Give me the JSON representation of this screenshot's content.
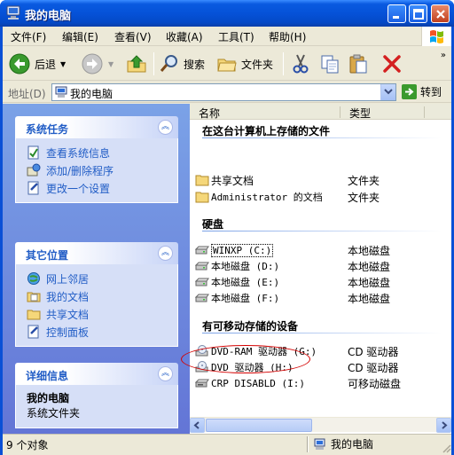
{
  "window": {
    "title": "我的电脑"
  },
  "menu": [
    "文件(F)",
    "编辑(E)",
    "查看(V)",
    "收藏(A)",
    "工具(T)",
    "帮助(H)"
  ],
  "toolbar": {
    "back": "后退",
    "search": "搜索",
    "folders": "文件夹"
  },
  "address": {
    "label": "地址(D)",
    "value": "我的电脑",
    "go": "转到"
  },
  "tasks": {
    "system": {
      "title": "系统任务",
      "items": [
        "查看系统信息",
        "添加/删除程序",
        "更改一个设置"
      ]
    },
    "other": {
      "title": "其它位置",
      "items": [
        "网上邻居",
        "我的文档",
        "共享文档",
        "控制面板"
      ]
    },
    "details": {
      "title": "详细信息",
      "name": "我的电脑",
      "desc": "系统文件夹"
    }
  },
  "columns": {
    "name": "名称",
    "type": "类型"
  },
  "groups": [
    {
      "title": "在这台计算机上存储的文件",
      "items": [
        {
          "name": "共享文档",
          "type": "文件夹",
          "icon": "folder"
        },
        {
          "name": "Administrator 的文档",
          "type": "文件夹",
          "icon": "folder"
        }
      ]
    },
    {
      "title": "硬盘",
      "items": [
        {
          "name": "WINXP (C:)",
          "type": "本地磁盘",
          "icon": "hard-drive"
        },
        {
          "name": "本地磁盘 (D:)",
          "type": "本地磁盘",
          "icon": "hard-drive"
        },
        {
          "name": "本地磁盘 (E:)",
          "type": "本地磁盘",
          "icon": "hard-drive"
        },
        {
          "name": "本地磁盘 (F:)",
          "type": "本地磁盘",
          "icon": "hard-drive"
        }
      ]
    },
    {
      "title": "有可移动存储的设备",
      "items": [
        {
          "name": "DVD-RAM 驱动器 (G:)",
          "type": "CD 驱动器",
          "icon": "dvd-drive"
        },
        {
          "name": "DVD 驱动器 (H:)",
          "type": "CD 驱动器",
          "icon": "dvd-drive"
        },
        {
          "name": "CRP DISABLD (I:)",
          "type": "可移动磁盘",
          "icon": "removable-drive"
        }
      ]
    }
  ],
  "status": {
    "count": "9 个对象",
    "location": "我的电脑"
  },
  "colors": {
    "title_bar": "#0552d8",
    "task_pane": "#6f8fe0",
    "link": "#215dc6",
    "highlight_ellipse": "#d40000"
  }
}
